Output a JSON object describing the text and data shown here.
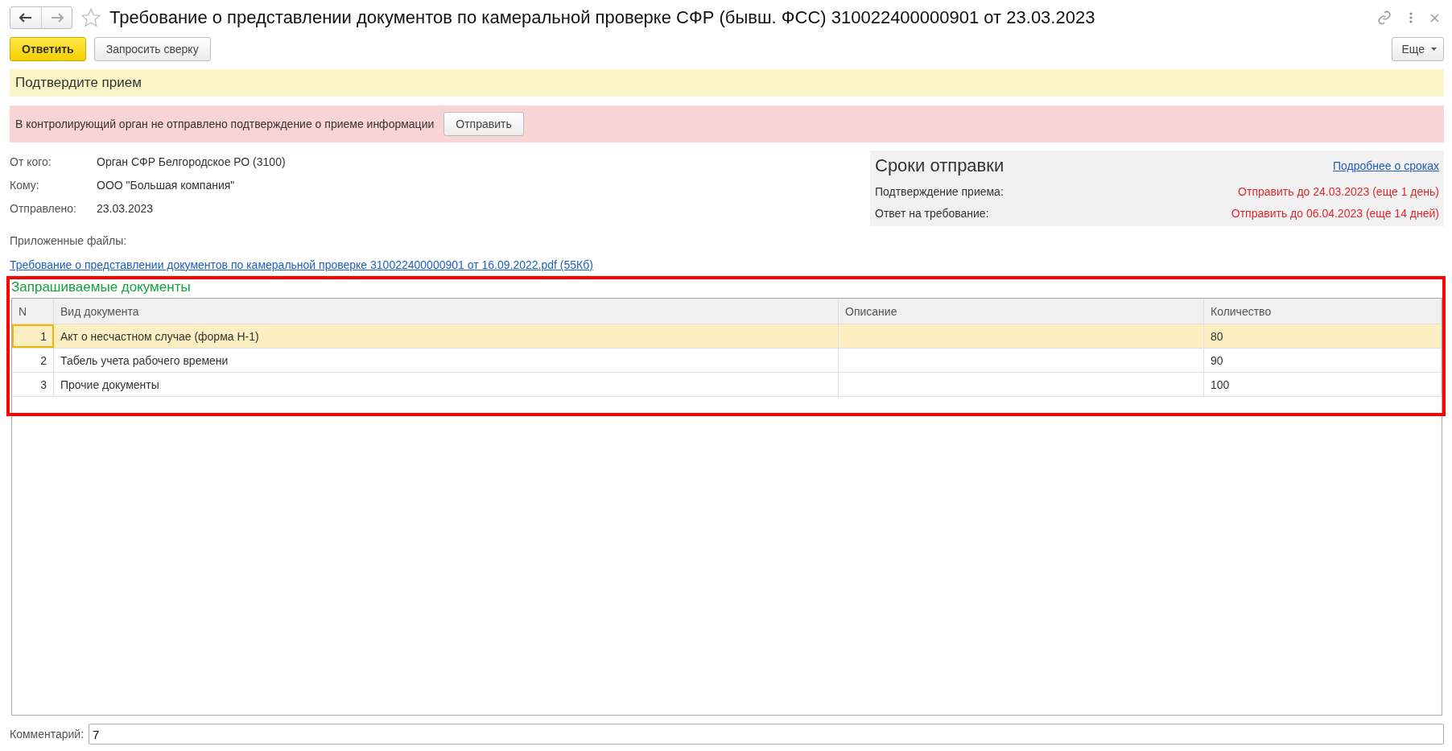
{
  "window": {
    "title": "Требование о представлении документов по камеральной проверке СФР (бывш. ФСС) 310022400000901 от 23.03.2023",
    "favorite": false
  },
  "toolbar": {
    "buttons": [
      {
        "label": "Ответить",
        "kind": "primary"
      },
      {
        "label": "Запросить сверку",
        "kind": "normal"
      }
    ],
    "more": "Еще"
  },
  "notice": "Подтвердите прием",
  "warning": {
    "text": "В контролирующий орган не отправлено подтверждение о приеме информации",
    "button": "Отправить"
  },
  "fields": [
    {
      "label": "От кого:",
      "value": "Орган СФР Белгородское РО (3100)"
    },
    {
      "label": "Кому:",
      "value": "ООО \"Большая компания\""
    },
    {
      "label": "Отправлено:",
      "value": "23.03.2023"
    }
  ],
  "deadlines": {
    "title": "Сроки отправки",
    "link": "Подробнее о сроках",
    "rows": [
      {
        "label": "Подтверждение приема:",
        "value": "Отправить до 24.03.2023 (еще 1 день)"
      },
      {
        "label": "Ответ на требование:",
        "value": "Отправить до 06.04.2023 (еще 14 дней)"
      }
    ]
  },
  "attachments": {
    "label": "Приложенные файлы:",
    "files": [
      "Требование о представлении документов по камеральной проверке 310022400000901 от 16.09.2022.pdf (55Кб)"
    ]
  },
  "documents": {
    "title": "Запрашиваемые документы",
    "columns": [
      "N",
      "Вид документа",
      "Описание",
      "Количество"
    ],
    "rows": [
      {
        "n": "1",
        "type": "Акт о несчастном случае (форма Н-1)",
        "count": "80",
        "selected": true
      },
      {
        "n": "2",
        "type": "Табель учета рабочего времени",
        "count": "90",
        "selected": false
      },
      {
        "n": "3",
        "type": "Прочие документы",
        "count": "100",
        "selected": false
      }
    ]
  },
  "comment": {
    "label": "Комментарий:",
    "value": "7"
  }
}
